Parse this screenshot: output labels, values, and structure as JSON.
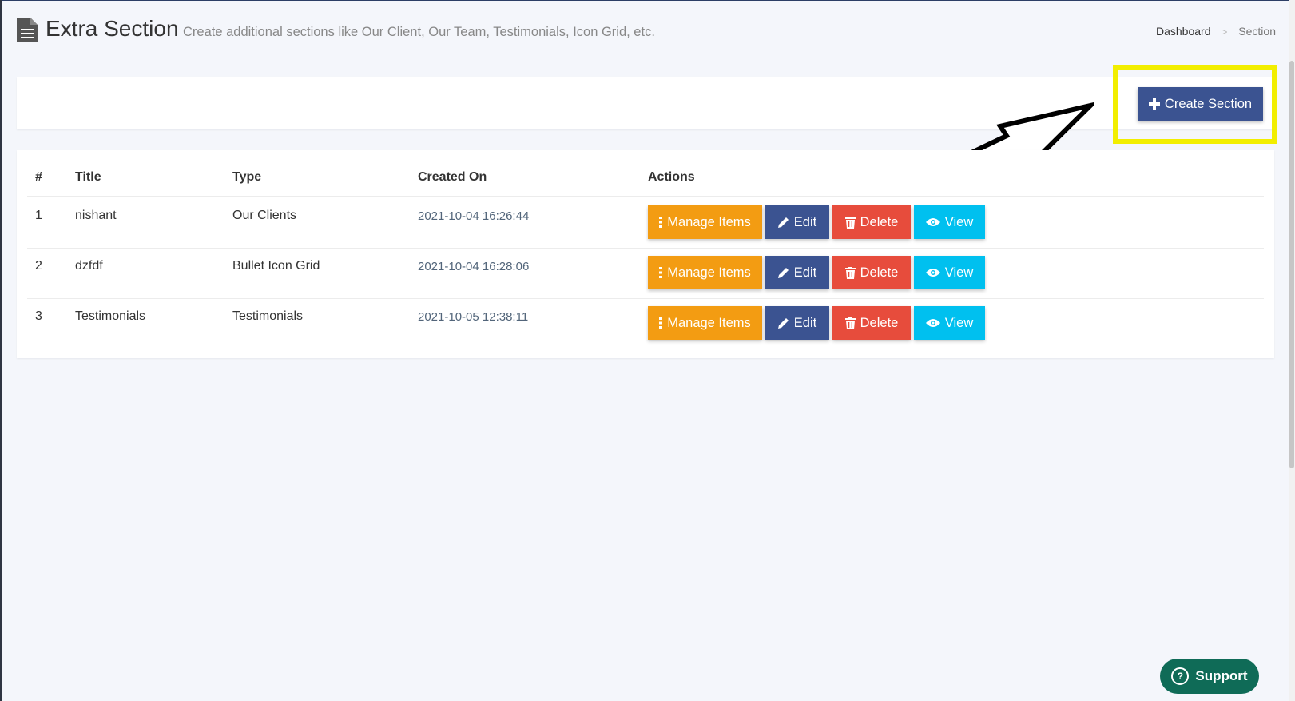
{
  "page": {
    "title": "Extra Section",
    "subtitle": "Create additional sections like Our Client, Our Team, Testimonials, Icon Grid, etc.",
    "icon": "document-icon"
  },
  "breadcrumb": {
    "items": [
      "Dashboard",
      "Section"
    ],
    "separator": ">"
  },
  "toolbar": {
    "create_label": "Create Section",
    "create_icon": "plus-icon"
  },
  "table": {
    "headers": [
      "#",
      "Title",
      "Type",
      "Created On",
      "Actions"
    ],
    "rows": [
      {
        "num": "1",
        "title": "nishant",
        "type": "Our Clients",
        "created": "2021-10-04 16:26:44"
      },
      {
        "num": "2",
        "title": "dzfdf",
        "type": "Bullet Icon Grid",
        "created": "2021-10-04 16:28:06"
      },
      {
        "num": "3",
        "title": "Testimonials",
        "type": "Testimonials",
        "created": "2021-10-05 12:38:11"
      }
    ],
    "actions": {
      "manage": "Manage Items",
      "edit": "Edit",
      "delete": "Delete",
      "view": "View"
    }
  },
  "support": {
    "label": "Support",
    "icon": "question-circle-icon"
  },
  "colors": {
    "primary": "#3b5391",
    "warning": "#f39c12",
    "danger": "#e74c3c",
    "info": "#00c0ef",
    "highlight": "#f2ee00",
    "support": "#0f6b57",
    "background": "#f4f6fb"
  }
}
